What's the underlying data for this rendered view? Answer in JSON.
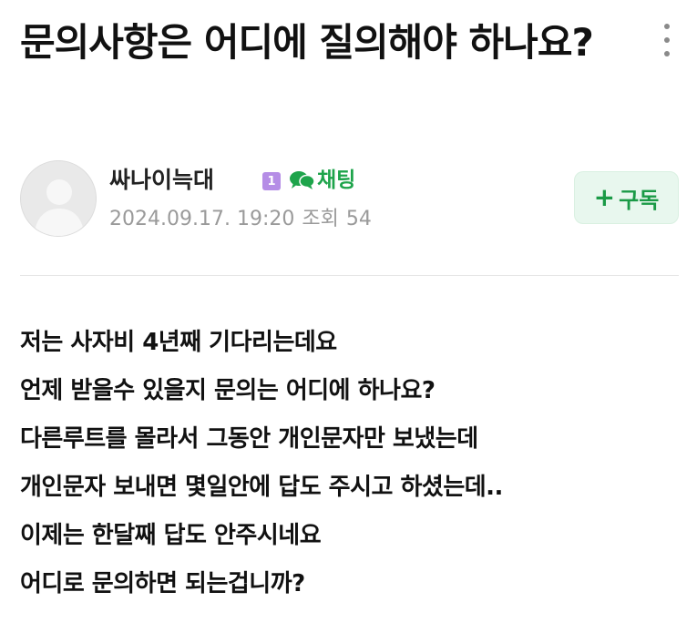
{
  "post": {
    "title": "문의사항은 어디에 질의해야 하나요?"
  },
  "author": {
    "nickname": "싸나이늑대",
    "level": "1",
    "chat_label": "채팅",
    "date": "2024.09.17. 19:20",
    "views_label": "조회",
    "views": "54",
    "subscribe_label": "구독",
    "subscribe_plus": "+"
  },
  "body": {
    "lines": [
      "저는 사자비 4년째 기다리는데요",
      "언제 받을수 있을지 문의는 어디에 하나요?",
      "다른루트를 몰라서 그동안 개인문자만 보냈는데",
      "개인문자 보내면 몇일안에 답도 주시고 하셨는데..",
      "이제는 한달째 답도 안주시네요",
      "어디로 문의하면 되는겁니까?"
    ]
  },
  "colors": {
    "accent_green": "#1ea44b",
    "level_badge": "#b58de6",
    "subscribe_bg": "#e8f7ee",
    "meta_gray": "#9a9a9a"
  },
  "icons": {
    "more": "more-vertical-icon",
    "chat": "chat-bubble-icon",
    "avatar": "default-avatar-icon"
  }
}
